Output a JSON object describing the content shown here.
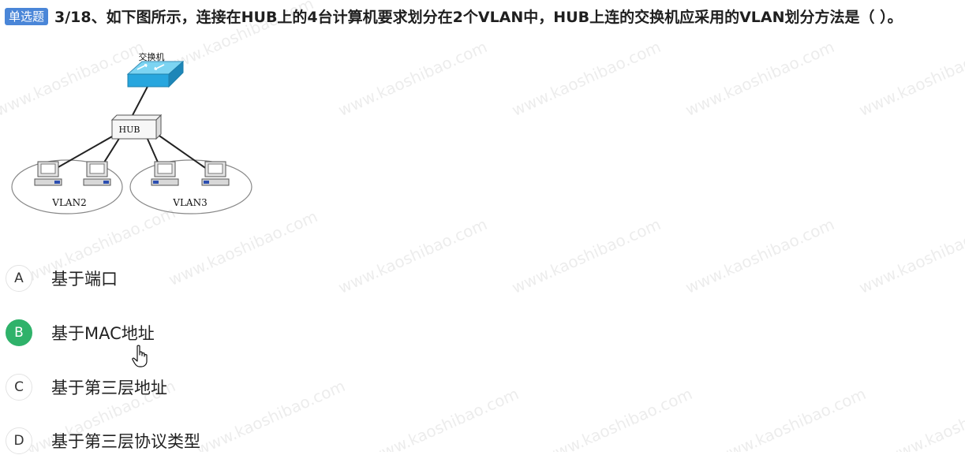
{
  "question": {
    "type_tag": "单选题",
    "text": "3/18、如下图所示，连接在HUB上的4台计算机要求划分在2个VLAN中，HUB上连的交换机应采用的VLAN划分方法是（ ）。"
  },
  "diagram": {
    "switch_label": "交换机",
    "hub_label": "HUB",
    "vlan_left": "VLAN2",
    "vlan_right": "VLAN3"
  },
  "options": [
    {
      "letter": "A",
      "text": "基于端口"
    },
    {
      "letter": "B",
      "text": "基于MAC地址",
      "selected": true
    },
    {
      "letter": "C",
      "text": "基于第三层地址"
    },
    {
      "letter": "D",
      "text": "基于第三层协议类型"
    }
  ],
  "watermark": "www.kaoshibao.com",
  "colors": {
    "selected": "#2fb26a",
    "tag": "#4a86d8"
  },
  "icons": {
    "cursor": "hand-pointer-icon"
  }
}
